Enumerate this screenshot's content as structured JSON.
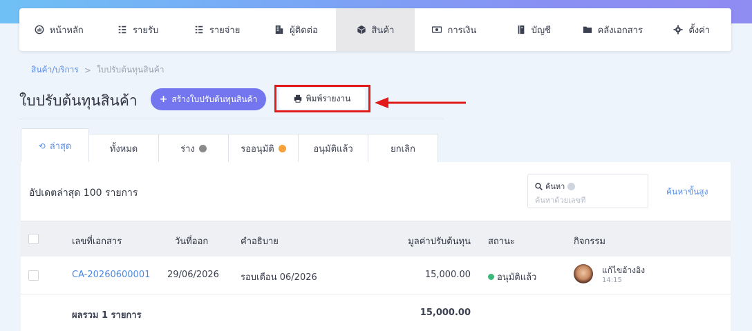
{
  "nav": {
    "items": [
      {
        "label": "หน้าหลัก",
        "icon": "dashboard-icon"
      },
      {
        "label": "รายรับ",
        "icon": "list-icon"
      },
      {
        "label": "รายจ่าย",
        "icon": "list-icon"
      },
      {
        "label": "ผู้ติดต่อ",
        "icon": "building-icon"
      },
      {
        "label": "สินค้า",
        "icon": "box-icon"
      },
      {
        "label": "การเงิน",
        "icon": "money-icon"
      },
      {
        "label": "บัญชี",
        "icon": "book-icon"
      },
      {
        "label": "คลังเอกสาร",
        "icon": "folder-icon"
      },
      {
        "label": "ตั้งค่า",
        "icon": "gear-icon"
      }
    ],
    "active_index": 4
  },
  "breadcrumb": {
    "parent": "สินค้า/บริการ",
    "separator": ">",
    "current": "ใบปรับต้นทุนสินค้า"
  },
  "page": {
    "title": "ใบปรับต้นทุนสินค้า",
    "create_label": "สร้างใบปรับต้นทุนสินค้า",
    "print_label": "พิมพ์รายงาน"
  },
  "tabs": [
    {
      "label": "ล่าสุด",
      "active": true
    },
    {
      "label": "ทั้งหมด"
    },
    {
      "label": "ร่าง",
      "dot_color": "#8a8a8a"
    },
    {
      "label": "รออนุมัติ",
      "dot_color": "#f6a13a"
    },
    {
      "label": "อนุมัติแล้ว"
    },
    {
      "label": "ยกเลิก"
    }
  ],
  "list": {
    "updated_text": "อัปเดตล่าสุด 100 รายการ",
    "search_label": "ค้นหา",
    "search_placeholder": "ค้นหาด้วยเลขที่",
    "advanced_search": "ค้นหาขั้นสูง"
  },
  "table": {
    "headers": {
      "doc_no": "เลขที่เอกสาร",
      "date": "วันที่ออก",
      "desc": "คำอธิบาย",
      "amount": "มูลค่าปรับต้นทุน",
      "status": "สถานะ",
      "activity": "กิจกรรม"
    },
    "rows": [
      {
        "doc_no": "CA-20260600001",
        "date": "29/06/2026",
        "desc": "รอบเดือน 06/2026",
        "amount": "15,000.00",
        "status": "อนุมัติแล้ว",
        "status_color": "#3cb878",
        "activity_text": "แก้ไขอ้างอิง",
        "activity_time": "14:15"
      }
    ],
    "footer": {
      "label": "ผลรวม 1 รายการ",
      "total": "15,000.00"
    }
  },
  "colors": {
    "accent": "#7376ee",
    "link": "#4f8be0",
    "highlight": "#e21a1a"
  }
}
